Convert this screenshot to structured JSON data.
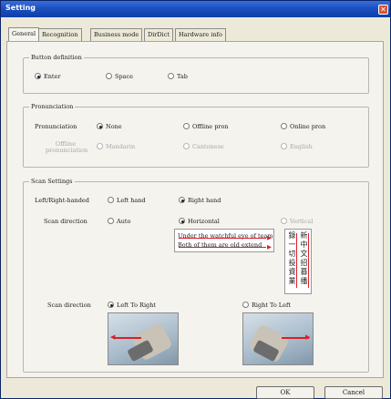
{
  "window": {
    "title": "Setting"
  },
  "tabs": [
    {
      "label": "General"
    },
    {
      "label": "Recognition"
    },
    {
      "label": "Business mode"
    },
    {
      "label": "DirDict"
    },
    {
      "label": "Hardware info"
    }
  ],
  "button_definition": {
    "legend": "Button definition",
    "options": [
      "Enter",
      "Space",
      "Tab"
    ],
    "selected": "Enter"
  },
  "pronunciation": {
    "legend": "Pronunciation",
    "row1_label": "Pronunciation",
    "row1_options": [
      "None",
      "Offline pron",
      "Online pron"
    ],
    "row1_selected": "None",
    "row2_label": "Offline pronunciation",
    "row2_options": [
      "Mandarin",
      "Cantonese",
      "English"
    ]
  },
  "scan_settings": {
    "legend": "Scan Settings",
    "hand_label": "Left/Right-handed",
    "hand_options": [
      "Left hand",
      "Right hand"
    ],
    "hand_selected": "Right hand",
    "direction_label": "Scan direction",
    "direction_options": [
      "Auto",
      "Horizontal",
      "Vertical"
    ],
    "direction_selected": "Horizontal",
    "sample_lines": [
      "Under the watchful eye of team",
      "Both of them are old extend"
    ],
    "vertical_cols": [
      [
        "錄",
        "一",
        "切",
        "投",
        "資",
        "業"
      ],
      [
        "新",
        "中",
        "文",
        "招",
        "募",
        "播"
      ]
    ],
    "scan_dir_label": "Scan direction",
    "scan_dir_options": [
      "Left To Right",
      "Right To Left"
    ],
    "scan_dir_selected": "Left To Right"
  },
  "footer": {
    "ok": "OK",
    "cancel": "Cancel"
  },
  "colors": {
    "title_bar": "#1c4fc0",
    "close_button": "#d9532b",
    "scan_line": "#d9202a"
  }
}
